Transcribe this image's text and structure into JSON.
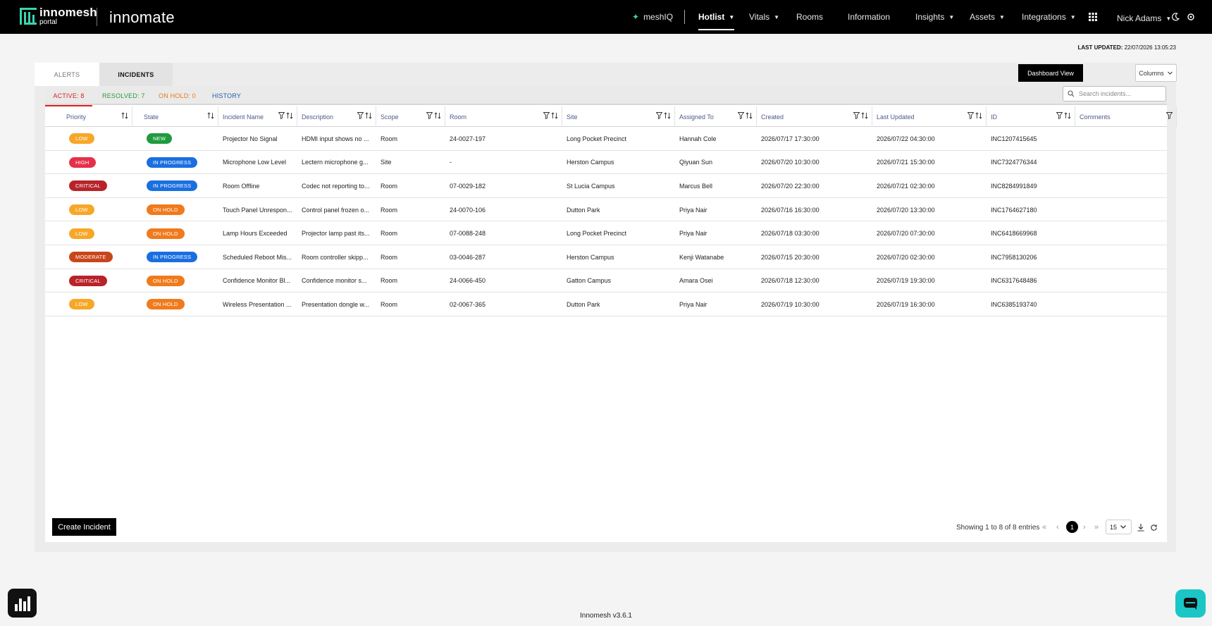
{
  "header": {
    "logo_text": "innomesh",
    "logo_sub": "portal",
    "brand": "innomate",
    "nav": [
      {
        "label": "meshIQ"
      },
      {
        "label": "Hotlist"
      },
      {
        "label": "Vitals"
      },
      {
        "label": "Rooms"
      },
      {
        "label": "Information"
      },
      {
        "label": "Insights"
      },
      {
        "label": "Assets"
      },
      {
        "label": "Integrations"
      }
    ],
    "user": "Nick Adams"
  },
  "last_updated": {
    "label": "LAST UPDATED:",
    "value": "22/07/2026 13:05:23"
  },
  "tabs": {
    "alerts": "ALERTS",
    "incidents": "INCIDENTS"
  },
  "toolbar": {
    "dashboard_view": "Dashboard View",
    "columns": "Columns",
    "search_placeholder": "Search incidents..."
  },
  "subtabs": {
    "active": "ACTIVE: 8",
    "resolved": "RESOLVED: 7",
    "on_hold": "ON HOLD: 0",
    "history": "HISTORY"
  },
  "columns": [
    "Priority",
    "State",
    "Incident Name",
    "Description",
    "Scope",
    "Room",
    "Site",
    "Assigned To",
    "Created",
    "Last Updated",
    "ID",
    "Comments"
  ],
  "colors": {
    "low": "#f7a728",
    "high": "#e5304a",
    "critical": "#b8232a",
    "moderate": "#c8461a",
    "new": "#1f9a3e",
    "in_progress": "#1a6fe0",
    "on_hold": "#f07a1c"
  },
  "rows": [
    {
      "priority": "LOW",
      "pclass": "low",
      "state": "NEW",
      "sclass": "new",
      "name": "Projector No Signal",
      "desc": "HDMI input shows no ...",
      "scope": "Room",
      "room": "24-0027-197",
      "site": "Long Pocket Precinct",
      "assigned": "Hannah Cole",
      "created": "2026/07/17 17:30:00",
      "updated": "2026/07/22 04:30:00",
      "id": "INC1207415645"
    },
    {
      "priority": "HIGH",
      "pclass": "high",
      "state": "IN PROGRESS",
      "sclass": "in_progress",
      "name": "Microphone Low Level",
      "desc": "Lectern microphone g...",
      "scope": "Site",
      "room": "-",
      "site": "Herston Campus",
      "assigned": "Qiyuan Sun",
      "created": "2026/07/20 10:30:00",
      "updated": "2026/07/21 15:30:00",
      "id": "INC7324776344"
    },
    {
      "priority": "CRITICAL",
      "pclass": "critical",
      "state": "IN PROGRESS",
      "sclass": "in_progress",
      "name": "Room Offline",
      "desc": "Codec not reporting to...",
      "scope": "Room",
      "room": "07-0029-182",
      "site": "St Lucia Campus",
      "assigned": "Marcus Bell",
      "created": "2026/07/20 22:30:00",
      "updated": "2026/07/21 02:30:00",
      "id": "INC8284991849"
    },
    {
      "priority": "LOW",
      "pclass": "low",
      "state": "ON HOLD",
      "sclass": "on_hold",
      "name": "Touch Panel Unrespon...",
      "desc": "Control panel frozen o...",
      "scope": "Room",
      "room": "24-0070-106",
      "site": "Dutton Park",
      "assigned": "Priya Nair",
      "created": "2026/07/16 16:30:00",
      "updated": "2026/07/20 13:30:00",
      "id": "INC1764627180"
    },
    {
      "priority": "LOW",
      "pclass": "low",
      "state": "ON HOLD",
      "sclass": "on_hold",
      "name": "Lamp Hours Exceeded",
      "desc": "Projector lamp past its...",
      "scope": "Room",
      "room": "07-0088-248",
      "site": "Long Pocket Precinct",
      "assigned": "Priya Nair",
      "created": "2026/07/18 03:30:00",
      "updated": "2026/07/20 07:30:00",
      "id": "INC6418669968"
    },
    {
      "priority": "MODERATE",
      "pclass": "moderate",
      "state": "IN PROGRESS",
      "sclass": "in_progress",
      "name": "Scheduled Reboot Mis...",
      "desc": "Room controller skipp...",
      "scope": "Room",
      "room": "03-0046-287",
      "site": "Herston Campus",
      "assigned": "Kenji Watanabe",
      "created": "2026/07/15 20:30:00",
      "updated": "2026/07/20 02:30:00",
      "id": "INC7958130206"
    },
    {
      "priority": "CRITICAL",
      "pclass": "critical",
      "state": "ON HOLD",
      "sclass": "on_hold",
      "name": "Confidence Monitor Bl...",
      "desc": "Confidence monitor s...",
      "scope": "Room",
      "room": "24-0066-450",
      "site": "Gatton Campus",
      "assigned": "Amara Osei",
      "created": "2026/07/18 12:30:00",
      "updated": "2026/07/19 19:30:00",
      "id": "INC6317648486"
    },
    {
      "priority": "LOW",
      "pclass": "low",
      "state": "ON HOLD",
      "sclass": "on_hold",
      "name": "Wireless Presentation ...",
      "desc": "Presentation dongle w...",
      "scope": "Room",
      "room": "02-0067-365",
      "site": "Dutton Park",
      "assigned": "Priya Nair",
      "created": "2026/07/19 10:30:00",
      "updated": "2026/07/19 16:30:00",
      "id": "INC6385193740"
    }
  ],
  "footer": {
    "create_incident": "Create Incident",
    "showing": "Showing 1 to 8 of 8 entries",
    "current_page": "1",
    "page_size": "15",
    "version": "Innomesh v3.6.1"
  }
}
